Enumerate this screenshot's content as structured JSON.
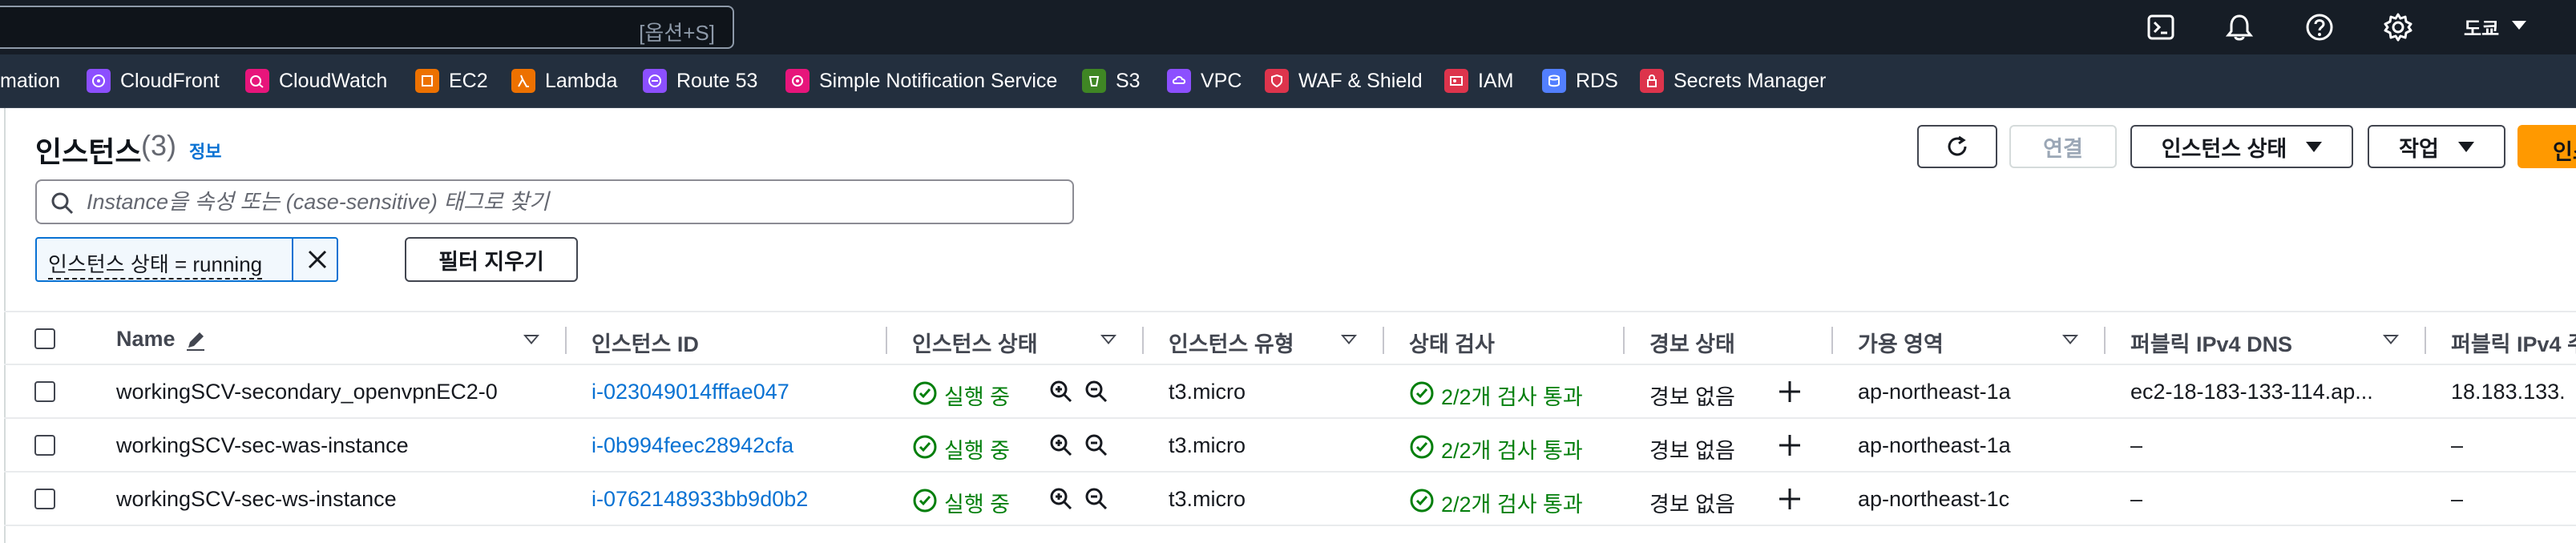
{
  "topnav": {
    "search_shortcut": "[옵션+S]",
    "icons": [
      "cloudshell-icon",
      "bell-icon",
      "help-icon",
      "gear-icon"
    ],
    "region": "도쿄"
  },
  "favorites": [
    {
      "label": "mation",
      "icon": null,
      "color": null
    },
    {
      "label": "CloudFront",
      "icon": "cloudfront-icon",
      "color": "#8c4fff"
    },
    {
      "label": "CloudWatch",
      "icon": "cloudwatch-icon",
      "color": "#e7157b"
    },
    {
      "label": "EC2",
      "icon": "ec2-icon",
      "color": "#ed7100"
    },
    {
      "label": "Lambda",
      "icon": "lambda-icon",
      "color": "#ed7100"
    },
    {
      "label": "Route 53",
      "icon": "route53-icon",
      "color": "#8c4fff"
    },
    {
      "label": "Simple Notification Service",
      "icon": "sns-icon",
      "color": "#e7157b"
    },
    {
      "label": "S3",
      "icon": "s3-icon",
      "color": "#3f8624"
    },
    {
      "label": "VPC",
      "icon": "vpc-icon",
      "color": "#8c4fff"
    },
    {
      "label": "WAF & Shield",
      "icon": "waf-icon",
      "color": "#dd344c"
    },
    {
      "label": "IAM",
      "icon": "iam-icon",
      "color": "#dd344c"
    },
    {
      "label": "RDS",
      "icon": "rds-icon",
      "color": "#527fff"
    },
    {
      "label": "Secrets Manager",
      "icon": "secrets-icon",
      "color": "#dd344c"
    }
  ],
  "header": {
    "title": "인스턴스",
    "count": "(3)",
    "info": "정보",
    "connect": "연결",
    "instance_state": "인스턴스 상태",
    "actions": "작업",
    "launch": "인스"
  },
  "filter": {
    "placeholder": "Instance을 속성 또는 (case-sensitive) 태그로 찾기",
    "token": "인스턴스 상태 = running",
    "clear": "필터 지우기"
  },
  "table": {
    "columns": [
      "Name",
      "인스턴스 ID",
      "인스턴스 상태",
      "인스턴스 유형",
      "상태 검사",
      "경보 상태",
      "가용 영역",
      "퍼블릭 IPv4 DNS",
      "퍼블릭 IPv4 주"
    ],
    "rows": [
      {
        "name": "workingSCV-secondary_openvpnEC2-0",
        "id": "i-023049014fffae047",
        "state": "실행 중",
        "type": "t3.micro",
        "check": "2/2개 검사 통과",
        "alarm": "경보 없음",
        "az": "ap-northeast-1a",
        "dns": "ec2-18-183-133-114.ap...",
        "ip": "18.183.133."
      },
      {
        "name": "workingSCV-sec-was-instance",
        "id": "i-0b994feec28942cfa",
        "state": "실행 중",
        "type": "t3.micro",
        "check": "2/2개 검사 통과",
        "alarm": "경보 없음",
        "az": "ap-northeast-1a",
        "dns": "–",
        "ip": "–"
      },
      {
        "name": "workingSCV-sec-ws-instance",
        "id": "i-0762148933bb9d0b2",
        "state": "실행 중",
        "type": "t3.micro",
        "check": "2/2개 검사 통과",
        "alarm": "경보 없음",
        "az": "ap-northeast-1c",
        "dns": "–",
        "ip": "–"
      }
    ]
  }
}
